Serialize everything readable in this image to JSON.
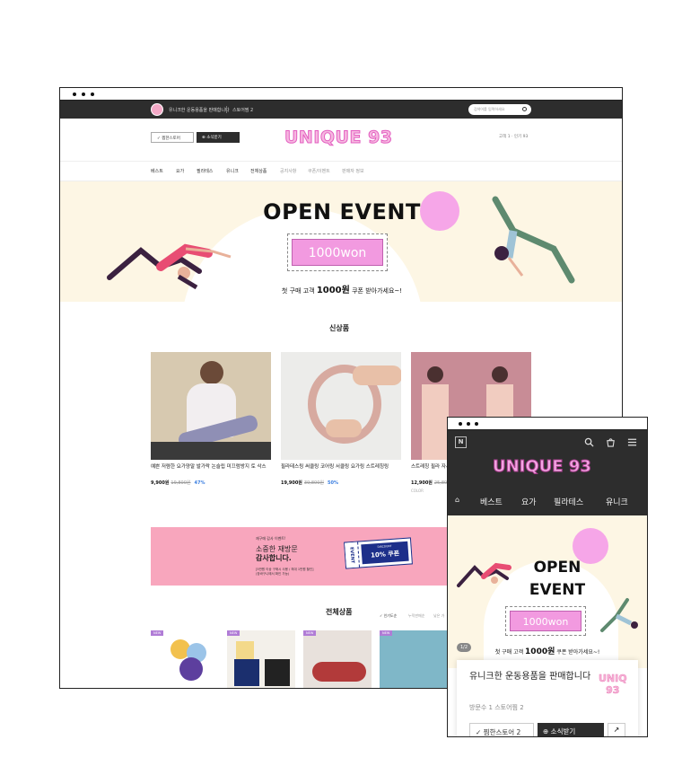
{
  "desktop": {
    "topbar": {
      "message": "유니크한 운동용품을 판매합니다",
      "follow": "스토어찜 2",
      "search_placeholder": "검색어를 입력하세요"
    },
    "header": {
      "fav_store": "✓ 찜한스토어",
      "news": "⊕ 소식받기",
      "logo": "UNIQUE 93",
      "right": "고객 1 · 인기 93"
    },
    "nav": [
      "베스트",
      "요가",
      "필라테스",
      "유니크",
      "전체상품",
      "공지사항",
      "쿠폰/이벤트",
      "판매자 정보"
    ],
    "banner": {
      "title": "OPEN EVENT",
      "coupon": "1000won",
      "sub_pre": "첫 구매 고객 ",
      "sub_amt": "1000원",
      "sub_post": " 쿠폰 받아가세요~!"
    },
    "new_title": "신상품",
    "products": [
      {
        "name": "예쁜 저렴한 요가양말 발가락 논슬립 미끄럼방지 토 삭스",
        "price": "9,900원",
        "orig": "19,800원",
        "disc": "47%"
      },
      {
        "name": "필라테스링 써클링 코어링 서클링 요가링 스트레칭링",
        "price": "19,900원",
        "orig": "39,800원",
        "disc": "50%"
      },
      {
        "name": "스트레칭 필라 자세교정 밸런",
        "price": "12,900원",
        "orig": "25,800",
        "disc": "",
        "extra": "COLOR"
      }
    ],
    "event": {
      "small": "재구매 감사 이벤트!",
      "line1": "소중한 재방문",
      "line2": "감사합니다.",
      "fine1": "[5만원 이상 구매시 사용 / 최대 1만원 할인]",
      "fine2": "(장바구니에서 확인 가능)",
      "ticket_side": "EVENT",
      "ticket_top": "DISCOUNT",
      "ticket_main": "10% 쿠폰"
    },
    "all_title": "전체상품",
    "sort": [
      "✓ 인기도순",
      "누적판매순",
      "낮은 가"
    ],
    "badge": "NEW"
  },
  "mobile": {
    "logo": "UNIQUE 93",
    "nav": [
      "베스트",
      "요가",
      "필라테스",
      "유니크"
    ],
    "banner": {
      "title1": "OPEN",
      "title2": "EVENT",
      "coupon": "1000won",
      "sub_pre": "첫 구매 고객 ",
      "sub_amt": "1000원",
      "sub_post": " 쿠폰 받아가세요~!",
      "page": "1/2"
    },
    "card": {
      "name": "유니크한 운동용품을 판매합니다",
      "mini_logo1": "UNIQ",
      "mini_logo2": "93",
      "visits": "방문수 1  스토어찜 2",
      "fav": "✓ 찜한스토어 2",
      "news": "⊕ 소식받기",
      "share": "↗"
    }
  },
  "colors": {
    "dark": "#2d2d2d",
    "pink": "#f29ae0",
    "cream": "#fdf6e4",
    "blue": "#3a7ee0"
  }
}
